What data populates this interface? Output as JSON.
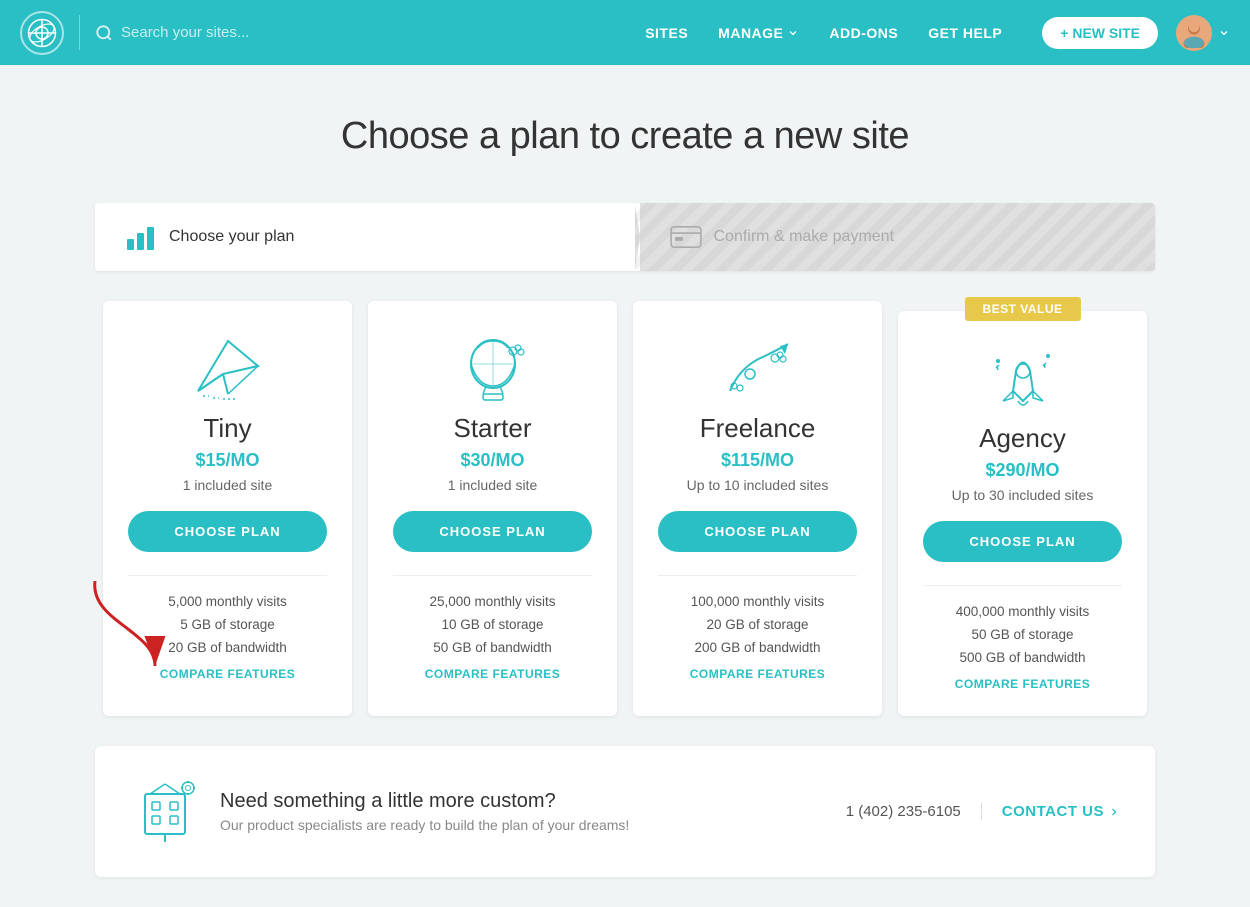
{
  "header": {
    "logo_alt": "Flywheel logo",
    "search_placeholder": "Search your sites...",
    "nav": {
      "sites": "SITES",
      "manage": "MANAGE",
      "addons": "ADD-ONS",
      "get_help": "GET HELP",
      "new_site": "+ NEW SITE"
    }
  },
  "page": {
    "title": "Choose a plan to create a new site"
  },
  "steps": {
    "step1_label": "Choose your plan",
    "step2_label": "Confirm & make payment"
  },
  "plans": [
    {
      "name": "Tiny",
      "price": "$15/MO",
      "sites": "1 included site",
      "btn_label": "CHOOSE PLAN",
      "monthly_visits": "5,000 monthly visits",
      "storage": "5 GB of storage",
      "bandwidth": "20 GB of bandwidth",
      "compare_label": "COMPARE FEATURES",
      "best_value": false
    },
    {
      "name": "Starter",
      "price": "$30/MO",
      "sites": "1 included site",
      "btn_label": "CHOOSE PLAN",
      "monthly_visits": "25,000 monthly visits",
      "storage": "10 GB of storage",
      "bandwidth": "50 GB of bandwidth",
      "compare_label": "COMPARE FEATURES",
      "best_value": false
    },
    {
      "name": "Freelance",
      "price": "$115/MO",
      "sites": "Up to 10 included sites",
      "btn_label": "CHOOSE PLAN",
      "monthly_visits": "100,000 monthly visits",
      "storage": "20 GB of storage",
      "bandwidth": "200 GB of bandwidth",
      "compare_label": "COMPARE FEATURES",
      "best_value": false
    },
    {
      "name": "Agency",
      "price": "$290/MO",
      "sites": "Up to 30 included sites",
      "btn_label": "CHOOSE PLAN",
      "monthly_visits": "400,000 monthly visits",
      "storage": "50 GB of storage",
      "bandwidth": "500 GB of bandwidth",
      "compare_label": "COMPARE FEATURES",
      "best_value": true,
      "best_value_label": "BEST VALUE"
    }
  ],
  "custom": {
    "title": "Need something a little more custom?",
    "subtitle": "Our product specialists are ready to build the plan of your dreams!",
    "phone": "1 (402) 235-6105",
    "contact_label": "CONTACT US"
  }
}
